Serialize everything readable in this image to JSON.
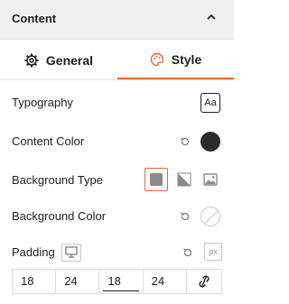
{
  "panel": {
    "section_title": "Content",
    "tabs": [
      {
        "label": "General",
        "icon": "gear-icon",
        "active": false
      },
      {
        "label": "Style",
        "icon": "palette-icon",
        "active": true
      }
    ],
    "accent_color": "#e2683b"
  },
  "typography": {
    "label": "Typography",
    "button_text": "Aa"
  },
  "content_color": {
    "label": "Content Color",
    "value": "#2b2b2b"
  },
  "background_type": {
    "label": "Background Type",
    "options": [
      "solid-color-icon",
      "gradient-icon",
      "image-icon"
    ],
    "selected": "solid-color-icon"
  },
  "background_color": {
    "label": "Background Color",
    "value": "none"
  },
  "padding": {
    "label": "Padding",
    "device_icon": "desktop-icon",
    "unit": "px",
    "values": [
      "18",
      "24",
      "18",
      "24"
    ],
    "linked_icon": "unlink-icon"
  }
}
